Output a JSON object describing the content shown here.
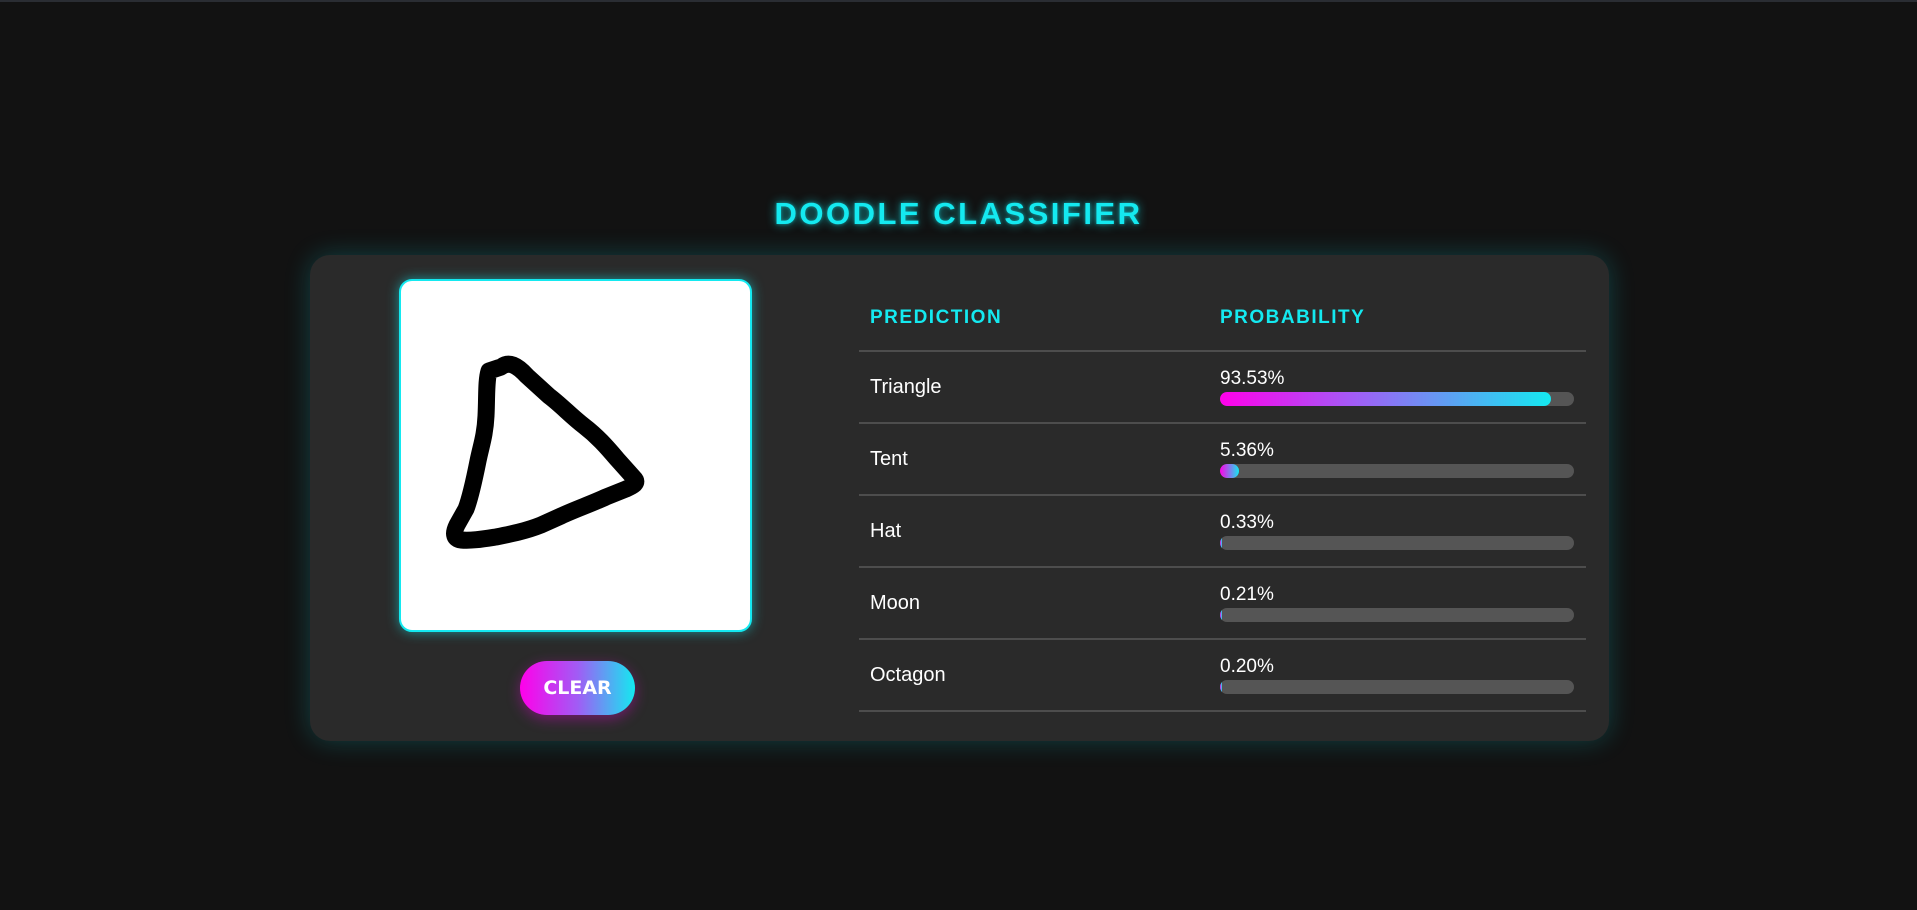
{
  "app": {
    "title": "DOODLE CLASSIFIER",
    "accent_color": "#14e9f0",
    "gradient_start": "#ff00ea",
    "gradient_end": "#14e9f0"
  },
  "canvas": {
    "drawing": "triangle-doodle"
  },
  "controls": {
    "clear_label": "CLEAR"
  },
  "table": {
    "headers": {
      "prediction": "PREDICTION",
      "probability": "PROBABILITY"
    },
    "rows": [
      {
        "label": "Triangle",
        "probability_text": "93.53%",
        "probability": 93.53
      },
      {
        "label": "Tent",
        "probability_text": "5.36%",
        "probability": 5.36
      },
      {
        "label": "Hat",
        "probability_text": "0.33%",
        "probability": 0.33
      },
      {
        "label": "Moon",
        "probability_text": "0.21%",
        "probability": 0.21
      },
      {
        "label": "Octagon",
        "probability_text": "0.20%",
        "probability": 0.2
      }
    ]
  }
}
